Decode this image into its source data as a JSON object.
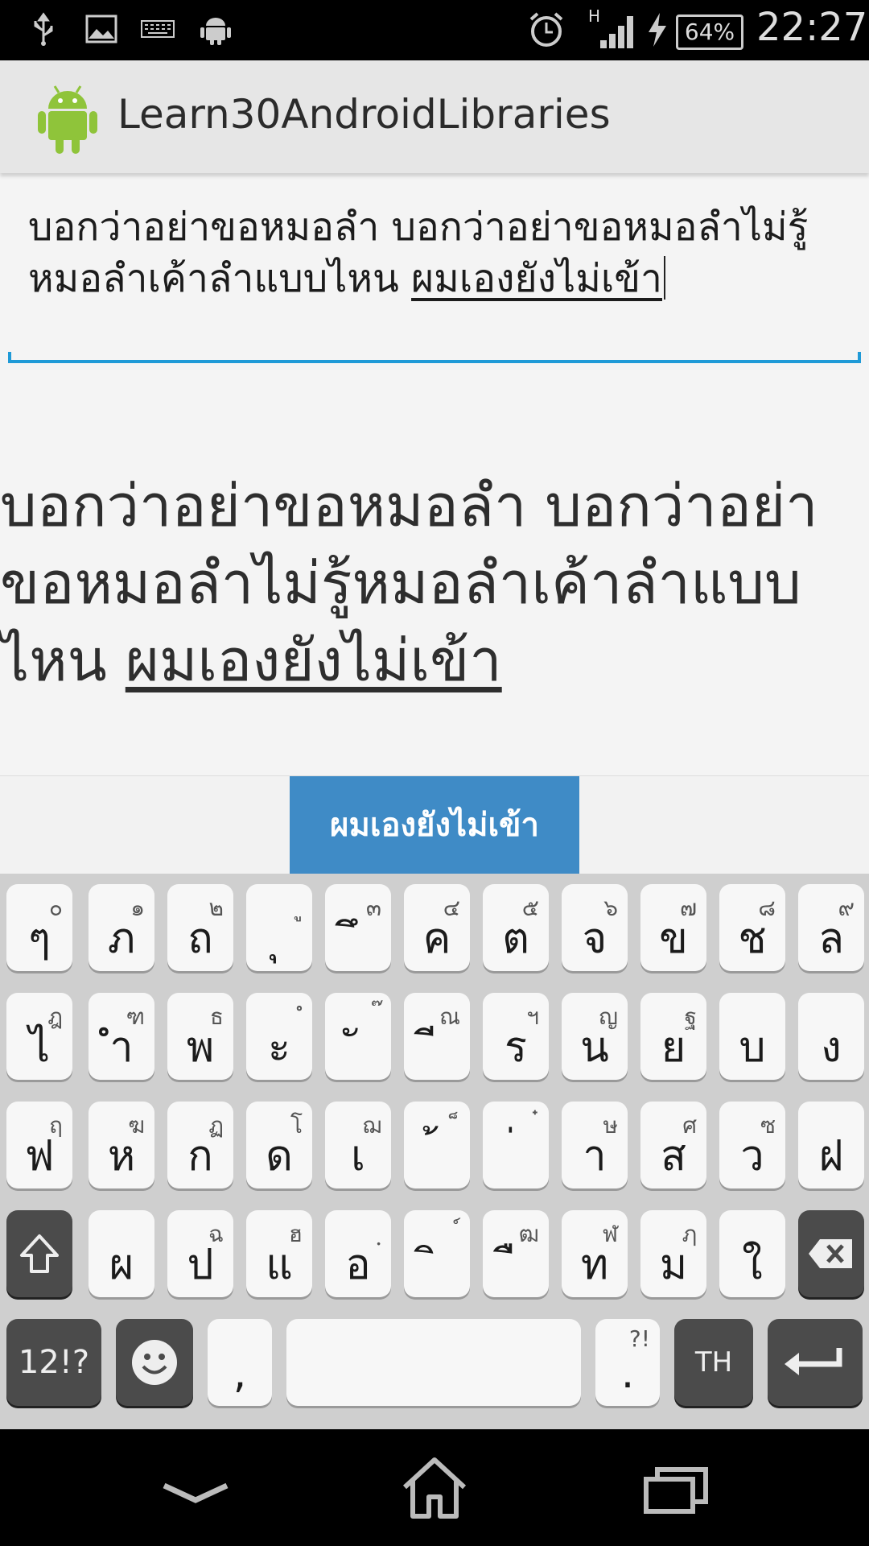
{
  "status_bar": {
    "time": "22:27",
    "battery": "64%",
    "network_type": "H",
    "left_icons": [
      "usb-icon",
      "image-icon",
      "keyboard-icon",
      "android-icon"
    ],
    "right_icons": [
      "alarm-icon",
      "signal-icon",
      "charging-icon",
      "battery-icon"
    ]
  },
  "app_bar": {
    "title": "Learn30AndroidLibraries",
    "icon": "android-robot-icon"
  },
  "edit_text": {
    "plain": "บอกว่าอย่าขอหมอลำ บอกว่าอย่าขอหมอลำไม่รู้หมอลำเค้าลำแบบไหน ",
    "composing": "ผมเองยังไม่เข้า"
  },
  "display_text": {
    "plain": "บอกว่าอย่าขอหมอลำ บอกว่าอย่าขอหมอลำไม่รู้หมอลำเค้าลำแบบไหน ",
    "underlined": "ผมเองยังไม่เข้า"
  },
  "suggestion": "ผมเองยังไม่เข้า",
  "keyboard": {
    "rows": [
      [
        {
          "m": "ๆ",
          "h": "๐"
        },
        {
          "m": "ภ",
          "h": "๑"
        },
        {
          "m": "ถ",
          "h": "๒"
        },
        {
          "m": "ุ",
          "h": "ู"
        },
        {
          "m": "ึ",
          "h": "๓"
        },
        {
          "m": "ค",
          "h": "๔"
        },
        {
          "m": "ต",
          "h": "๕"
        },
        {
          "m": "จ",
          "h": "๖"
        },
        {
          "m": "ข",
          "h": "๗"
        },
        {
          "m": "ช",
          "h": "๘"
        },
        {
          "m": "ล",
          "h": "๙"
        }
      ],
      [
        {
          "m": "ไ",
          "h": "ฎ"
        },
        {
          "m": "ำ",
          "h": "ฑ"
        },
        {
          "m": "พ",
          "h": "ธ"
        },
        {
          "m": "ะ",
          "h": "ํ"
        },
        {
          "m": "ั",
          "h": "๊"
        },
        {
          "m": "ี",
          "h": "ณ"
        },
        {
          "m": "ร",
          "h": "ฯ"
        },
        {
          "m": "น",
          "h": "ญ"
        },
        {
          "m": "ย",
          "h": "ฐ"
        },
        {
          "m": "บ",
          "h": ""
        },
        {
          "m": "ง",
          "h": ""
        }
      ],
      [
        {
          "m": "ฟ",
          "h": "ฤ"
        },
        {
          "m": "ห",
          "h": "ฆ"
        },
        {
          "m": "ก",
          "h": "ฏ"
        },
        {
          "m": "ด",
          "h": "โ"
        },
        {
          "m": "เ",
          "h": "ฌ"
        },
        {
          "m": "้",
          "h": "็"
        },
        {
          "m": "่",
          "h": "๋"
        },
        {
          "m": "า",
          "h": "ษ"
        },
        {
          "m": "ส",
          "h": "ศ"
        },
        {
          "m": "ว",
          "h": "ซ"
        },
        {
          "m": "ฝ",
          "h": ""
        }
      ],
      [
        {
          "m": "ผ",
          "h": ""
        },
        {
          "m": "ป",
          "h": "ฉ"
        },
        {
          "m": "แ",
          "h": "ฮ"
        },
        {
          "m": "อ",
          "h": "ฺ"
        },
        {
          "m": "ิ",
          "h": "์"
        },
        {
          "m": "ื",
          "h": "ฒ"
        },
        {
          "m": "ท",
          "h": "ฬ"
        },
        {
          "m": "ม",
          "h": "ฦ"
        },
        {
          "m": "ใ",
          "h": ""
        }
      ]
    ],
    "numbers_label": "12!?",
    "comma": ",",
    "period": ".",
    "period_hint": "?!",
    "language": "TH",
    "shift_icon": "shift-arrow-icon",
    "backspace_icon": "backspace-icon",
    "emoji_icon": "smiley-icon",
    "enter_icon": "enter-icon"
  },
  "nav_bar": {
    "icons": [
      "back-chevron-icon",
      "home-icon",
      "recents-icon"
    ]
  }
}
